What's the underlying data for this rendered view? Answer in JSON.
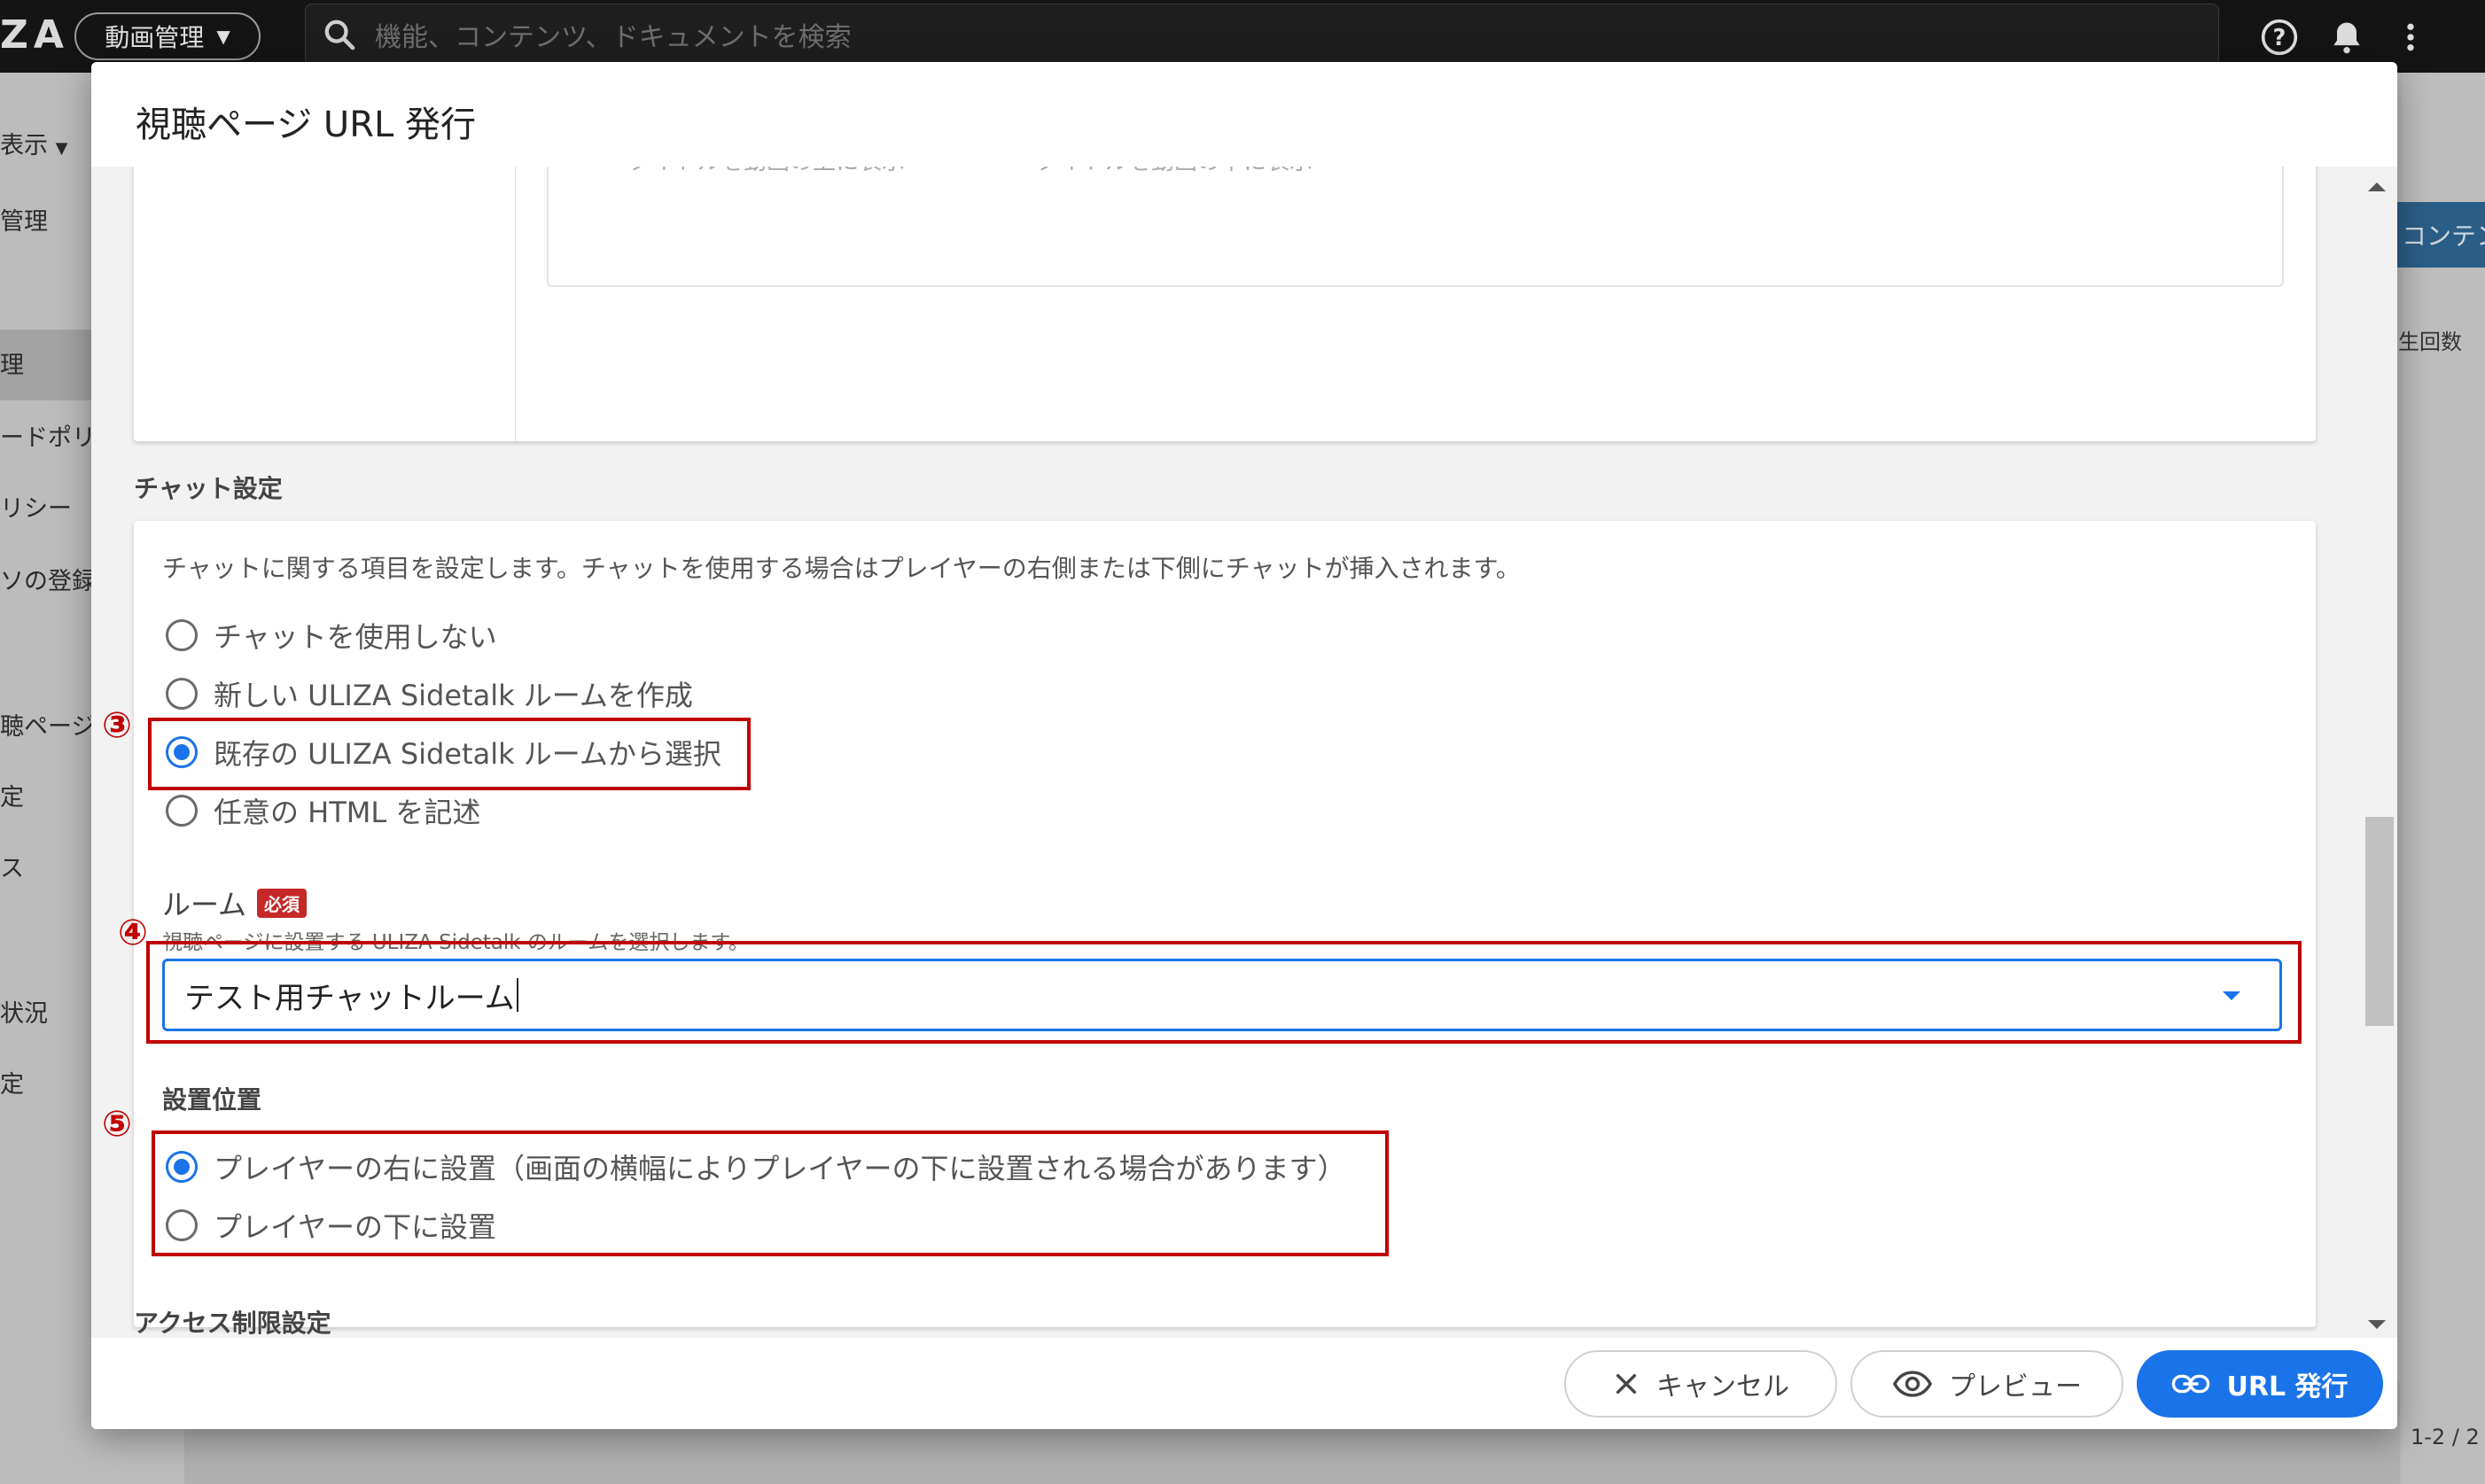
{
  "app": {
    "logo_text": "ZA",
    "mode_selector": "動画管理",
    "search_placeholder": "機能、コンテンツ、ドキュメントを検索"
  },
  "sidebar": {
    "view_label": "表示",
    "items": [
      "管理",
      "理",
      "ードポリ...",
      "リシー",
      "ソの登録",
      "聴ページ",
      "定",
      "ス",
      "状況",
      "定"
    ]
  },
  "background_right": {
    "button_label": "コンテン",
    "column_label": "生回数",
    "pager": "1-2 / 2"
  },
  "dialog": {
    "title": "視聴ページ URL 発行",
    "title_section": {
      "option_above": "タイトルを動画の上に表示",
      "option_below": "タイトルを動画の下に表示"
    },
    "chat_section": {
      "heading": "チャット設定",
      "description": "チャットに関する項目を設定します。チャットを使用する場合はプレイヤーの右側または下側にチャットが挿入されます。",
      "options": [
        {
          "label": "チャットを使用しない",
          "selected": false
        },
        {
          "label": "新しい ULIZA Sidetalk ルームを作成",
          "selected": false
        },
        {
          "label": "既存の ULIZA Sidetalk ルームから選択",
          "selected": true
        },
        {
          "label": "任意の HTML を記述",
          "selected": false
        }
      ],
      "room": {
        "label": "ルーム",
        "required_badge": "必須",
        "help": "視聴ページに設置する ULIZA Sidetalk のルームを選択します。",
        "selected_value": "テスト用チャットルーム"
      },
      "position": {
        "label": "設置位置",
        "options": [
          {
            "label": "プレイヤーの右に設置（画面の横幅によりプレイヤーの下に設置される場合があります）",
            "selected": true
          },
          {
            "label": "プレイヤーの下に設置",
            "selected": false
          }
        ]
      }
    },
    "access_section": {
      "heading": "アクセス制限設定"
    },
    "annotations": {
      "n3": "③",
      "n4": "④",
      "n5": "⑤"
    },
    "buttons": {
      "cancel": "キャンセル",
      "preview": "プレビュー",
      "issue": "URL 発行"
    }
  },
  "colors": {
    "accent": "#1a73e8",
    "annotation": "#c00000",
    "required": "#c62828"
  }
}
